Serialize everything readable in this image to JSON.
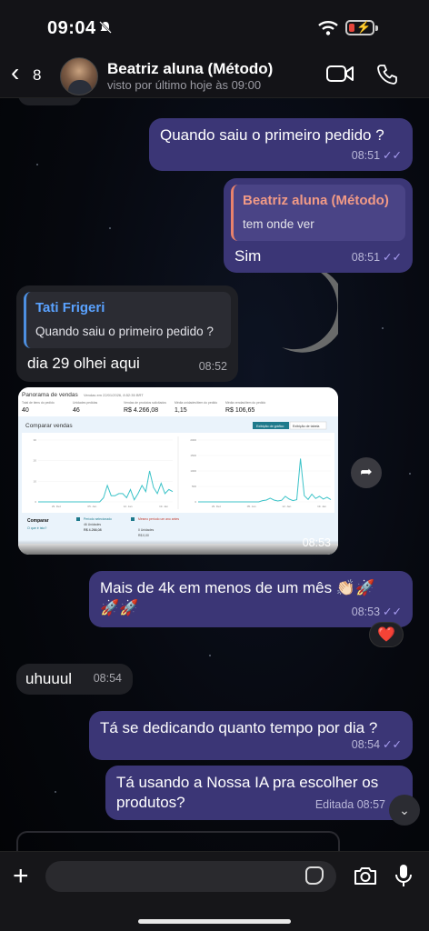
{
  "status_bar": {
    "time": "09:04"
  },
  "header": {
    "back_count": "8",
    "contact_name": "Beatriz aluna (Método)",
    "last_seen": "visto por último hoje às 09:00"
  },
  "messages": [
    {
      "id": "m1",
      "direction": "out",
      "text": "Quando saiu o primeiro pedido ?",
      "time": "08:51",
      "read": true
    },
    {
      "id": "m2",
      "direction": "out",
      "reply_to": {
        "name": "Beatriz aluna (Método)",
        "text": "tem onde ver"
      },
      "text": "Sim",
      "time": "08:51",
      "read": true
    },
    {
      "id": "m3",
      "direction": "in",
      "reply_to": {
        "name": "Tati Frigeri",
        "text": "Quando saiu o primeiro pedido ?"
      },
      "text": "dia 29 olhei aqui",
      "time": "08:52"
    },
    {
      "id": "m4",
      "direction": "in",
      "type": "image",
      "time": "08:53"
    },
    {
      "id": "m5",
      "direction": "out",
      "text": "Mais de 4k em menos de um mês 👏🏻🚀🚀🚀",
      "time": "08:53",
      "read": true,
      "reaction": "❤️"
    },
    {
      "id": "m6",
      "direction": "in",
      "text": "uhuuul",
      "time": "08:54"
    },
    {
      "id": "m7",
      "direction": "out",
      "text": "Tá se dedicando quanto tempo por dia ?",
      "time": "08:54",
      "read": true
    },
    {
      "id": "m8",
      "direction": "out",
      "text": "Tá usando a Nossa IA pra escolher os produtos?",
      "time": "Editada 08:57"
    }
  ],
  "screenshot": {
    "title": "Panorama de vendas",
    "subtitle": "Vendas em 22/01/2026, 8:52:35 BRT",
    "kpis": [
      {
        "label": "Total de itens do pedido",
        "value": "40"
      },
      {
        "label": "Unidades pedidas",
        "value": "46"
      },
      {
        "label": "Vendas de produtos solicitados",
        "value": "R$ 4.266,08"
      },
      {
        "label": "Média unidades/item do pedido",
        "value": "1,15"
      },
      {
        "label": "Média vendas/item do pedido",
        "value": "R$ 106,65"
      }
    ],
    "compare_title": "Comparar vendas",
    "tab_graph": "Exibição de gráfico",
    "tab_table": "Exibição de tabela",
    "chart_left_x": [
      "29. Dez",
      "05. Jan",
      "12. Jan",
      "19. Jan"
    ],
    "chart_left_y": [
      30,
      20,
      10,
      0
    ],
    "chart_left_values": [
      0,
      0,
      0,
      0,
      0,
      0,
      0,
      0,
      0,
      0,
      0,
      0,
      0,
      0,
      0,
      0,
      0,
      2,
      8,
      3,
      3,
      4,
      4,
      2,
      6,
      1,
      4,
      8,
      5,
      15,
      7,
      4,
      9,
      4,
      6,
      5
    ],
    "chart_right_x": [
      "29. Dez",
      "05. Jan",
      "12. Jan",
      "19. Jan"
    ],
    "chart_right_y": [
      2000,
      1500,
      1000,
      500,
      0
    ],
    "chart_right_values": [
      0,
      0,
      0,
      0,
      0,
      0,
      0,
      0,
      0,
      0,
      0,
      0,
      0,
      0,
      0,
      0,
      0,
      40,
      60,
      120,
      60,
      30,
      50,
      180,
      90,
      40,
      70,
      1400,
      200,
      80,
      250,
      110,
      180,
      90,
      150,
      70
    ],
    "compare_label": "Comparar",
    "compare_link": "O que é isto?",
    "legend_selected": "Período selecionado",
    "legend_selected_units": "46 Unidades",
    "legend_selected_sales": "R$ 4.266,08",
    "legend_prev": "Mesmo período um ano antes",
    "legend_prev_units": "0 Unidades",
    "legend_prev_sales": "R$ 0,00"
  },
  "composer": {
    "placeholder": ""
  }
}
